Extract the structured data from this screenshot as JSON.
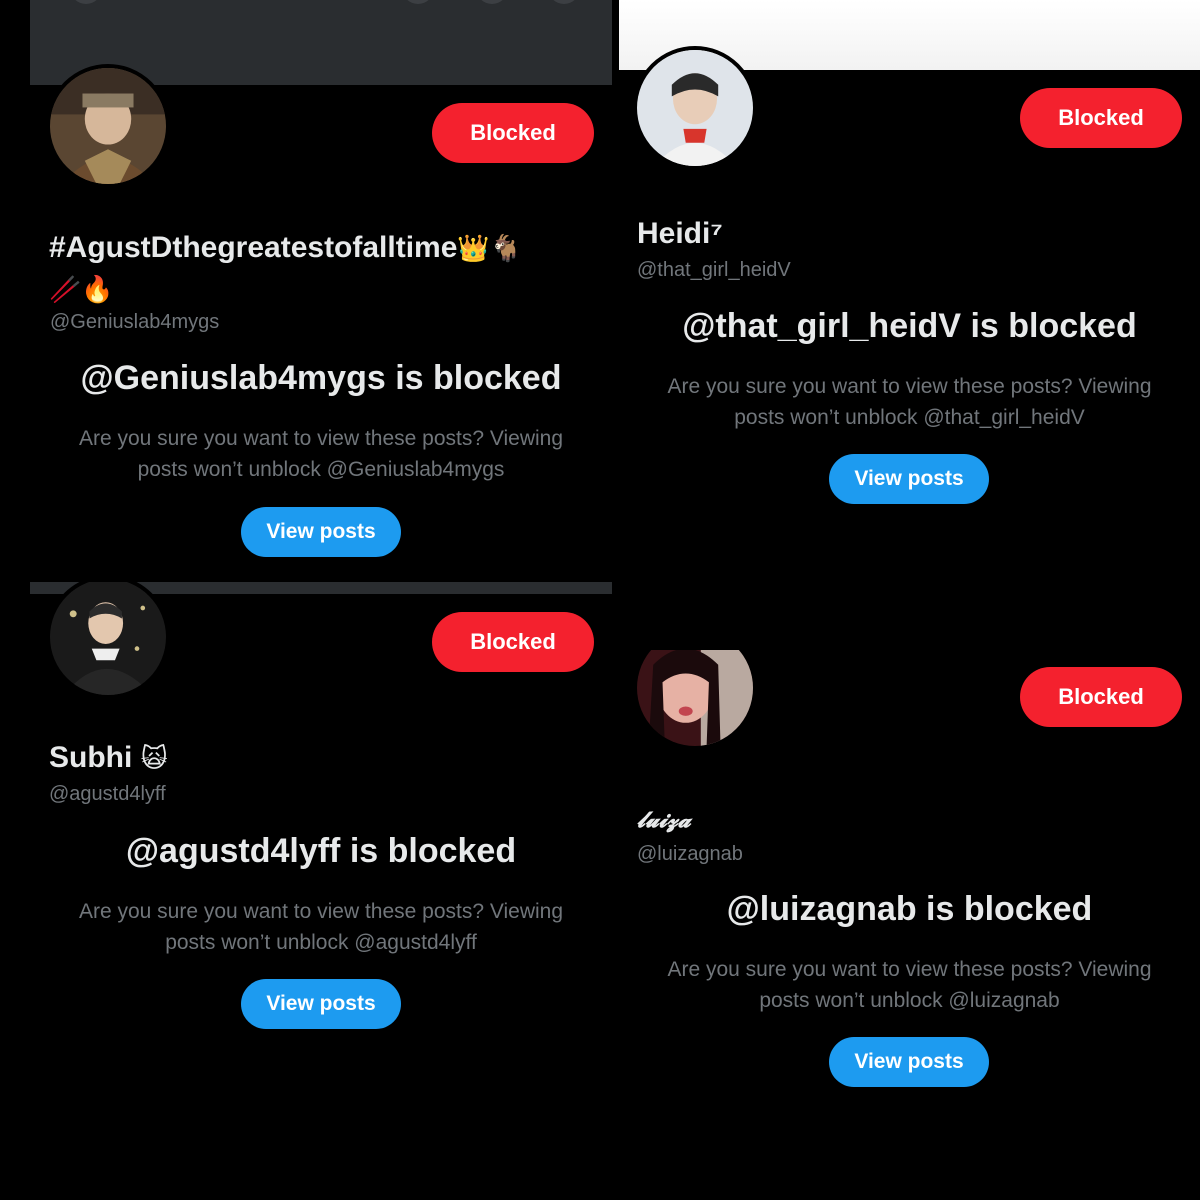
{
  "cards": [
    {
      "display_name": "#AgustDthegreatestofalltime",
      "name_emoji_1": "👑🐐",
      "name_emoji_2": "🥢🔥",
      "handle": "@Geniuslab4mygs",
      "blocked_label": "Blocked",
      "heading": "@Geniuslab4mygs is blocked",
      "desc_line1": "Are you sure you want to view these posts? Viewing",
      "desc_line2": "posts won’t unblock @Geniuslab4mygs",
      "view_label": "View posts"
    },
    {
      "display_name": "Heidi⁷",
      "handle": "@that_girl_heidV",
      "blocked_label": "Blocked",
      "heading": "@that_girl_heidV is blocked",
      "desc_line1": "Are you sure you want to view these posts? Viewing",
      "desc_line2": "posts won’t unblock @that_girl_heidV",
      "view_label": "View posts"
    },
    {
      "display_name": "Subhi",
      "name_emoji_1": "🙀",
      "handle": "@agustd4lyff",
      "blocked_label": "Blocked",
      "heading": "@agustd4lyff is blocked",
      "desc_line1": "Are you sure you want to view these posts? Viewing",
      "desc_line2": "posts won’t unblock @agustd4lyff",
      "view_label": "View posts"
    },
    {
      "display_name": "𝓵𝓾𝓲𝔃𝓪",
      "handle": "@luizagnab",
      "blocked_label": "Blocked",
      "heading": "@luizagnab is blocked",
      "desc_line1": "Are you sure you want to view these posts? Viewing",
      "desc_line2": "posts won’t unblock @luizagnab",
      "view_label": "View posts"
    }
  ],
  "colors": {
    "blocked_red": "#f4212e",
    "view_blue": "#1d9bf0",
    "text_primary": "#e7e9ea",
    "text_secondary": "#71767b",
    "background": "#000000"
  }
}
